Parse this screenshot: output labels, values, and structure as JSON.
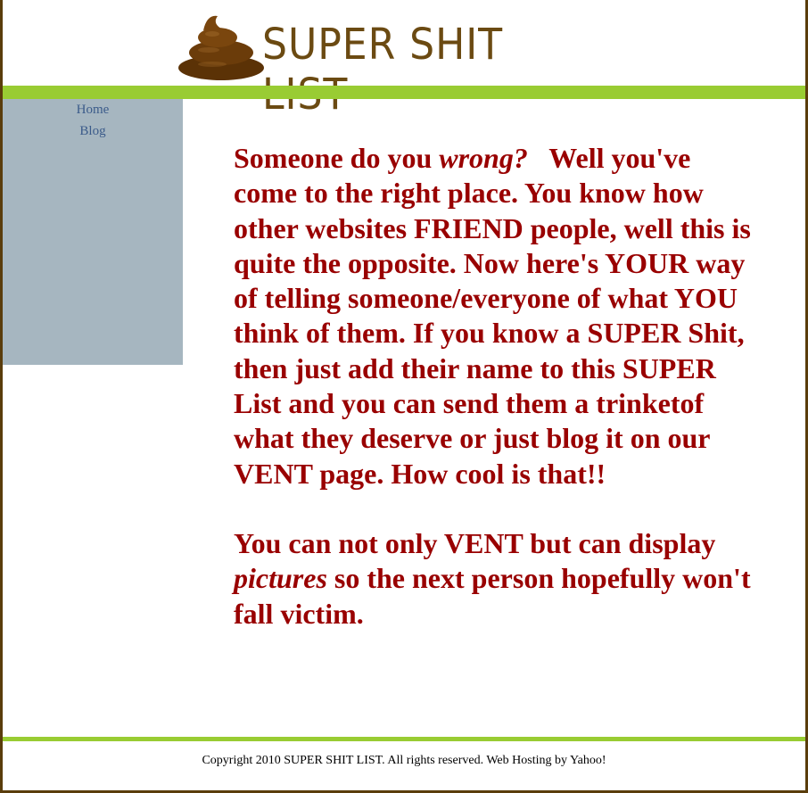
{
  "header": {
    "logo_text": "SUPER SHIT LIST",
    "logo_icon": "poop-icon"
  },
  "nav": {
    "items": [
      {
        "label": "Home"
      },
      {
        "label": "Blog"
      }
    ]
  },
  "main": {
    "p1_a": "Someone do you ",
    "p1_em": "wrong?",
    "p1_b": "   Well you've come to the right place. You know how other websites FRIEND people, well this is quite the opposite. Now here's YOUR way of telling someone/everyone of what YOU think of them. If you know a SUPER Shit, then just add their name to this SUPER List and you can send them a trinketof what they deserve or just blog it on our VENT page. How cool is that!!",
    "p2_a": "You can not only VENT but can display ",
    "p2_em": "pictures",
    "p2_b": " so the next person hopefully won't fall victim."
  },
  "footer": {
    "copyright": "Copyright 2010 SUPER SHIT LIST. All rights reserved. Web Hosting by Yahoo!"
  },
  "colors": {
    "accent_green": "#99cc33",
    "sidebar": "#a6b6c0",
    "text_red": "#990000",
    "frame_brown": "#5a3d0c"
  }
}
